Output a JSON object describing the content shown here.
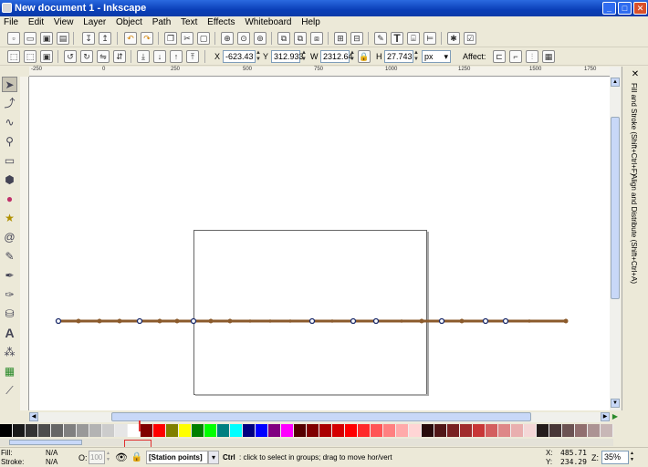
{
  "window": {
    "title": "New document 1 - Inkscape",
    "min": "_",
    "max": "□",
    "close": "✕"
  },
  "menu": [
    "File",
    "Edit",
    "View",
    "Layer",
    "Object",
    "Path",
    "Text",
    "Effects",
    "Whiteboard",
    "Help"
  ],
  "toolctrl": {
    "x_label": "X",
    "x_value": "-623.43",
    "y_label": "Y",
    "y_value": "312.933",
    "w_label": "W",
    "w_value": "2312.64",
    "h_label": "H",
    "h_value": "27.743",
    "unit": "px",
    "affect_label": "Affect:"
  },
  "ruler_ticks": [
    "-250",
    "0",
    "250",
    "500",
    "750",
    "1000",
    "1250",
    "1500",
    "1750"
  ],
  "dock": {
    "fill_stroke": "Fill and Stroke (Shift+Ctrl+F)",
    "align": "Align and Distribute (Shift+Ctrl+A)"
  },
  "palette_colors": [
    "#000000",
    "#1a1a1a",
    "#333333",
    "#4d4d4d",
    "#666666",
    "#808080",
    "#999999",
    "#b3b3b3",
    "#cccccc",
    "#e6e6e6",
    "#ffffff",
    "#800000",
    "#ff0000",
    "#808000",
    "#ffff00",
    "#008000",
    "#00ff00",
    "#008080",
    "#00ffff",
    "#000080",
    "#0000ff",
    "#800080",
    "#ff00ff",
    "#550000",
    "#800000",
    "#aa0000",
    "#d40000",
    "#ff0000",
    "#ff2a2a",
    "#ff5555",
    "#ff8080",
    "#ffaaaa",
    "#ffd5d5",
    "#280b0b",
    "#501616",
    "#782121",
    "#a02c2c",
    "#c83737",
    "#d35f5f",
    "#de8787",
    "#e9afaf",
    "#f4d7d7",
    "#241c1c",
    "#483737",
    "#6c5353",
    "#916f6f",
    "#ac9393",
    "#c8b7b7"
  ],
  "status": {
    "fill_label": "Fill:",
    "fill_value": "N/A",
    "stroke_label": "Stroke:",
    "stroke_value": "N/A",
    "opacity_label": "O:",
    "opacity_value": "100",
    "layer_name": "[Station points]",
    "message_bold": "Ctrl",
    "message": ": click to select in groups; drag to move hor/vert",
    "coord_x_label": "X:",
    "coord_x": "485.71",
    "coord_y_label": "Y:",
    "coord_y": "234.29",
    "zoom_label": "Z:",
    "zoom": "35%"
  },
  "colors": {
    "line": "#8b5a2b",
    "titlebar": "#0a3fb8",
    "highlight": "#e03030"
  }
}
